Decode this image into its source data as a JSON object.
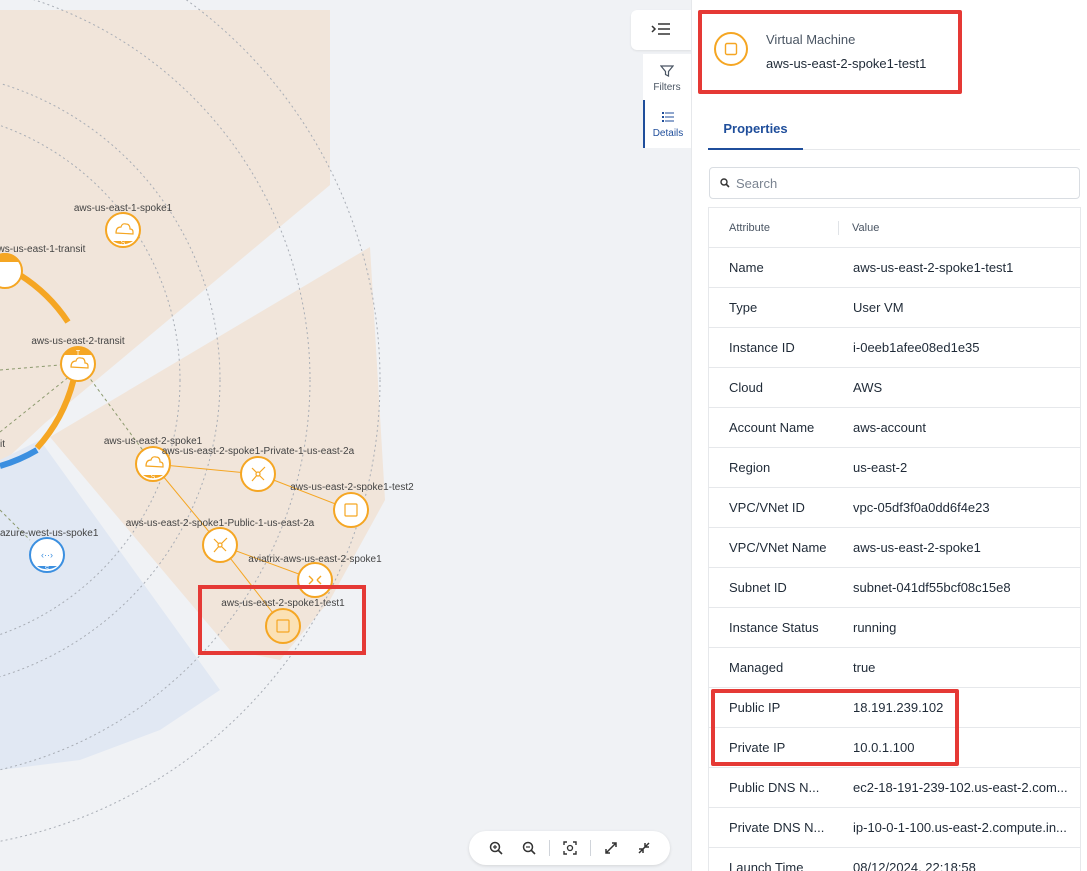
{
  "topology": {
    "nodes": [
      {
        "label": "aws-us-east-1-spoke1",
        "kind": "spoke",
        "badge": "S"
      },
      {
        "label": "aws-us-east-1-transit",
        "kind": "transit",
        "badge": "T"
      },
      {
        "label": "aws-us-east-2-transit",
        "kind": "transit",
        "badge": "T"
      },
      {
        "label": "aws-us-east-2-spoke1",
        "kind": "spoke",
        "badge": "S"
      },
      {
        "label": "aws-us-east-2-spoke1-Private-1-us-east-2a",
        "kind": "subnet"
      },
      {
        "label": "aws-us-east-2-spoke1-test2",
        "kind": "vm"
      },
      {
        "label": "aws-us-east-2-spoke1-Public-1-us-east-2a",
        "kind": "subnet"
      },
      {
        "label": "aviatrix-aws-us-east-2-spoke1",
        "kind": "gateway"
      },
      {
        "label": "aws-us-east-2-spoke1-test1",
        "kind": "vm",
        "selected": true
      },
      {
        "label": "azure-west-us-spoke1",
        "kind": "spoke",
        "badge": "S"
      },
      {
        "label": "it",
        "kind": "partial"
      }
    ]
  },
  "side_tabs": {
    "filters_label": "Filters",
    "details_label": "Details"
  },
  "panel": {
    "type_label": "Virtual Machine",
    "name": "aws-us-east-2-spoke1-test1",
    "tab_properties": "Properties",
    "search_placeholder": "Search",
    "col_attribute": "Attribute",
    "col_value": "Value",
    "rows": [
      {
        "attr": "Name",
        "value": "aws-us-east-2-spoke1-test1"
      },
      {
        "attr": "Type",
        "value": "User VM"
      },
      {
        "attr": "Instance ID",
        "value": "i-0eeb1afee08ed1e35"
      },
      {
        "attr": "Cloud",
        "value": "AWS"
      },
      {
        "attr": "Account Name",
        "value": "aws-account"
      },
      {
        "attr": "Region",
        "value": "us-east-2"
      },
      {
        "attr": "VPC/VNet ID",
        "value": "vpc-05df3f0a0dd6f4e23"
      },
      {
        "attr": "VPC/VNet Name",
        "value": "aws-us-east-2-spoke1"
      },
      {
        "attr": "Subnet ID",
        "value": "subnet-041df55bcf08c15e8"
      },
      {
        "attr": "Instance Status",
        "value": "running"
      },
      {
        "attr": "Managed",
        "value": "true"
      },
      {
        "attr": "Public IP",
        "value": "18.191.239.102"
      },
      {
        "attr": "Private IP",
        "value": "10.0.1.100"
      },
      {
        "attr": "Public DNS N...",
        "value": "ec2-18-191-239-102.us-east-2.com..."
      },
      {
        "attr": "Private DNS N...",
        "value": "ip-10-0-1-100.us-east-2.compute.in..."
      },
      {
        "attr": "Launch Time",
        "value": "08/12/2024, 22:18:58"
      }
    ]
  },
  "colors": {
    "aws_orange": "#f5a623",
    "azure_blue": "#3b8fe0",
    "highlight_red": "#e53935",
    "accent_blue": "#1f4e9b"
  }
}
